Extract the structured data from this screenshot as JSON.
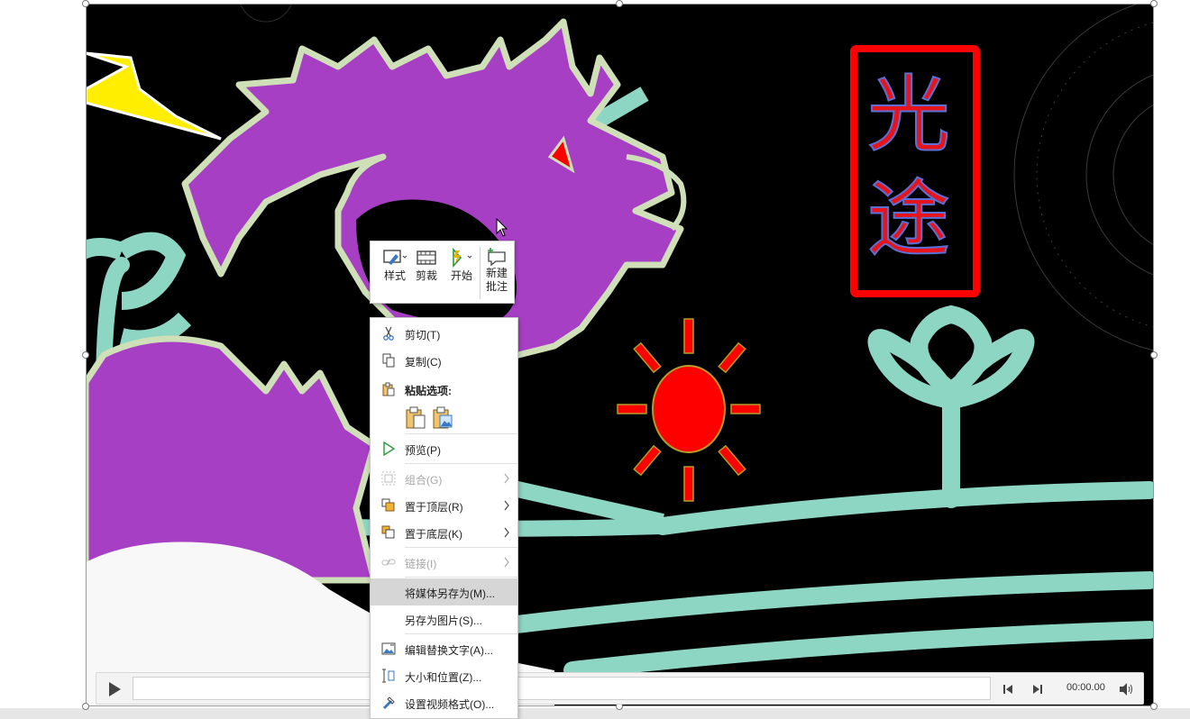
{
  "slide": {
    "title_chars": [
      "光",
      "途"
    ]
  },
  "video_controls": {
    "time": "00:00.00"
  },
  "mini_toolbar": {
    "buttons": [
      {
        "label": "样式"
      },
      {
        "label": "剪裁"
      },
      {
        "label": "开始"
      },
      {
        "label_line1": "新建",
        "label_line2": "批注"
      }
    ]
  },
  "context_menu": {
    "items": [
      {
        "label": "剪切(T)",
        "icon": "scissors-icon"
      },
      {
        "label": "复制(C)",
        "icon": "copy-icon"
      },
      {
        "label": "粘贴选项:",
        "icon": "paste-icon"
      },
      {
        "label": "预览(P)",
        "icon": "play-icon"
      },
      {
        "label": "组合(G)",
        "icon": "group-icon"
      },
      {
        "label": "置于顶层(R)",
        "icon": "bring-to-front-icon"
      },
      {
        "label": "置于底层(K)",
        "icon": "send-to-back-icon"
      },
      {
        "label": "链接(I)",
        "icon": "link-icon"
      },
      {
        "label": "将媒体另存为(M)...",
        "icon": ""
      },
      {
        "label": "另存为图片(S)...",
        "icon": ""
      },
      {
        "label": "编辑替换文字(A)...",
        "icon": "alt-text-icon"
      },
      {
        "label": "大小和位置(Z)...",
        "icon": "size-position-icon"
      },
      {
        "label": "设置视频格式(O)...",
        "icon": "format-video-icon"
      }
    ]
  },
  "colors": {
    "dragon": "#a63fc4",
    "dragon_outline": "#cfe0b8",
    "sprout": "#8ed6c4",
    "sun": "#ff0000",
    "title_frame": "#ff0000",
    "title_text": "#e8141c",
    "title_text_outline": "#5b6fd4",
    "lightning": "#ffee00"
  }
}
